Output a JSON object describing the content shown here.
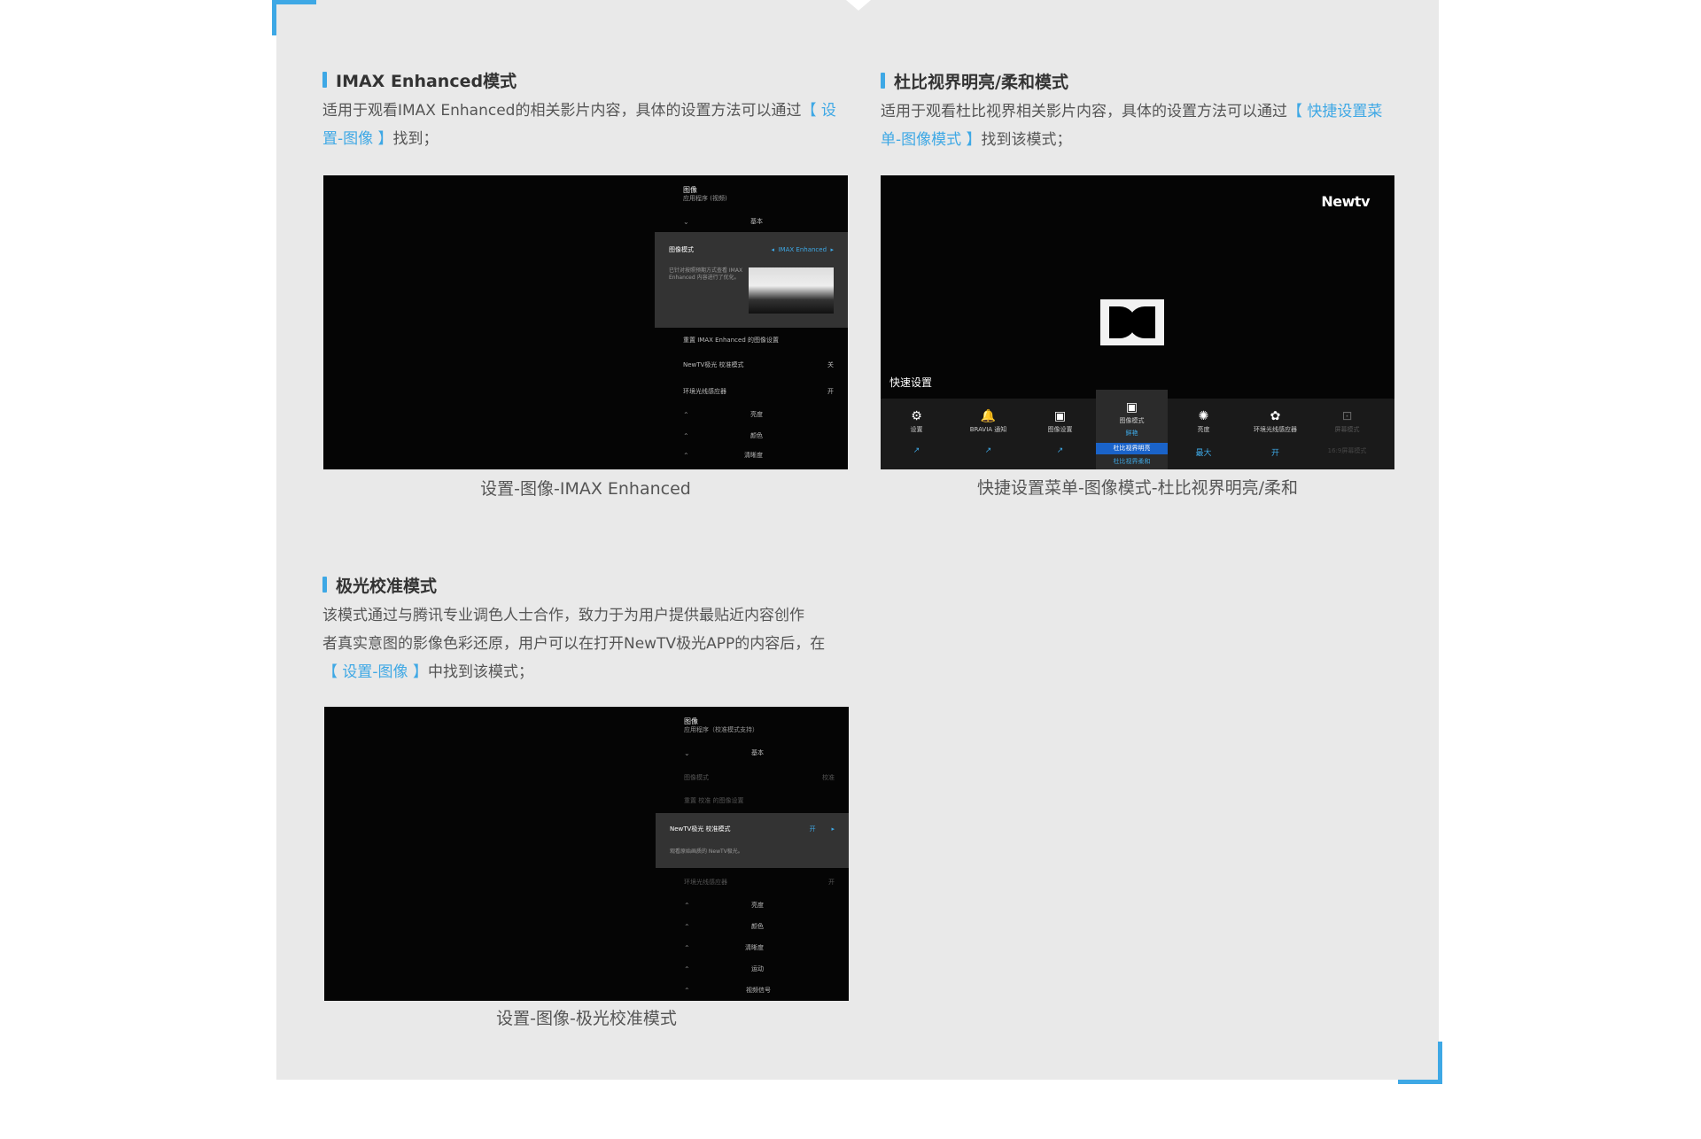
{
  "section1": {
    "title": "IMAX Enhanced模式",
    "desc_pre": "适用于观看IMAX Enhanced的相关影片内容，具体的设置方法可以通过",
    "desc_link": "【 设置-图像 】",
    "desc_post": "找到；",
    "caption": "设置-图像-IMAX Enhanced",
    "menu": {
      "title": "图像",
      "subtitle": "应用程序 (视频)",
      "basic": "基本",
      "mode_label": "图像模式",
      "mode_value": "IMAX Enhanced",
      "mode_desc": "已针对按照预期方式查看 IMAX Enhanced 内容进行了优化。",
      "reset": "重置 IMAX Enhanced 的图像设置",
      "newtv": "NewTV极光 校准模式",
      "newtv_val": "关",
      "ambient": "环境光线感应器",
      "ambient_val": "开",
      "brightness": "亮度",
      "color": "颜色",
      "clarity": "清晰度"
    }
  },
  "section2": {
    "title": "杜比视界明亮/柔和模式",
    "desc_pre": "适用于观看杜比视界相关影片内容，具体的设置方法可以通过",
    "desc_link": "【 快捷设置菜单-图像模式 】",
    "desc_post": "找到该模式；",
    "caption": "快捷设置菜单-图像模式-杜比视界明亮/柔和",
    "screen": {
      "brand": "Newtv",
      "quick_title": "快速设置",
      "items": [
        {
          "icon": "⚙",
          "label": "设置",
          "value": "↗"
        },
        {
          "icon": "🔔",
          "label": "BRAVIA 通知",
          "value": "↗"
        },
        {
          "icon": "▣",
          "label": "图像设置",
          "value": "↗"
        },
        {
          "icon": "▣",
          "label": "图像模式",
          "value": "鲜艳"
        },
        {
          "icon": "✺",
          "label": "亮度",
          "value": "最大"
        },
        {
          "icon": "✿",
          "label": "环境光线感应器",
          "value": "开"
        },
        {
          "icon": "⊡",
          "label": "屏幕模式",
          "value": "16:9屏幕模式"
        }
      ],
      "selected": "杜比视界明亮",
      "below_selected": "杜比视界柔和"
    }
  },
  "section3": {
    "title": "极光校准模式",
    "desc_line1": "该模式通过与腾讯专业调色人士合作，致力于为用户提供最贴近内容创作",
    "desc_line2": "者真实意图的影像色彩还原，用户可以在打开NewTV极光APP的内容后，在",
    "desc_link": "【 设置-图像 】",
    "desc_post": "中找到该模式；",
    "caption": "设置-图像-极光校准模式",
    "menu": {
      "title": "图像",
      "subtitle": "应用程序（校准模式支持）",
      "basic": "基本",
      "mode_label": "图像模式",
      "mode_value": "校准",
      "reset": "重置 校准 的图像设置",
      "newtv": "NewTV极光 校准模式",
      "newtv_val": "开",
      "newtv_desc": "观看原始画质的 NewTV极光。",
      "ambient": "环境光线感应器",
      "ambient_val": "开",
      "brightness": "亮度",
      "color": "颜色",
      "clarity": "清晰度",
      "motion": "运动",
      "signal": "视频信号"
    }
  }
}
